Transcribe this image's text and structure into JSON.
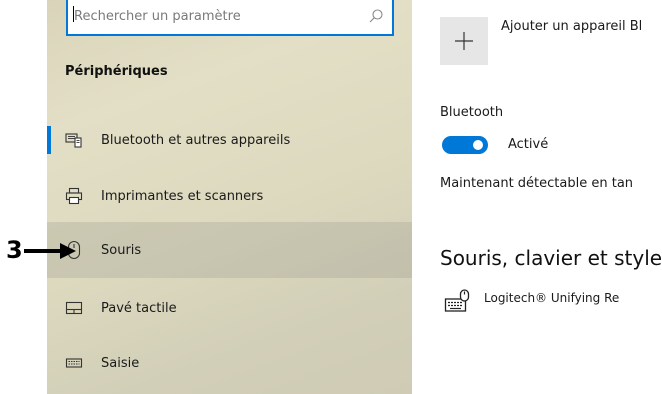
{
  "search": {
    "placeholder": "Rechercher un paramètre"
  },
  "sidebar": {
    "section_title": "Périphériques",
    "items": [
      {
        "label": "Bluetooth et autres appareils",
        "icon": "bluetooth-devices-icon",
        "selected": true
      },
      {
        "label": "Imprimantes et scanners",
        "icon": "printer-icon",
        "selected": false
      },
      {
        "label": "Souris",
        "icon": "mouse-icon",
        "selected": false,
        "hovered": true
      },
      {
        "label": "Pavé tactile",
        "icon": "touchpad-icon",
        "selected": false
      },
      {
        "label": "Saisie",
        "icon": "keyboard-icon",
        "selected": false
      }
    ]
  },
  "annotation": {
    "number": "3"
  },
  "main": {
    "add_device_label": "Ajouter un appareil Bl",
    "bluetooth_heading": "Bluetooth",
    "bluetooth_toggle_label": "Activé",
    "bluetooth_toggle_on": true,
    "discoverable_text": "Maintenant détectable en tan",
    "section_title": "Souris, clavier et style",
    "device_name": "Logitech® Unifying Re"
  },
  "colors": {
    "accent": "#0078d7",
    "sidebar_bg": "#ddd9bf",
    "hover": "#c9c6b2"
  }
}
